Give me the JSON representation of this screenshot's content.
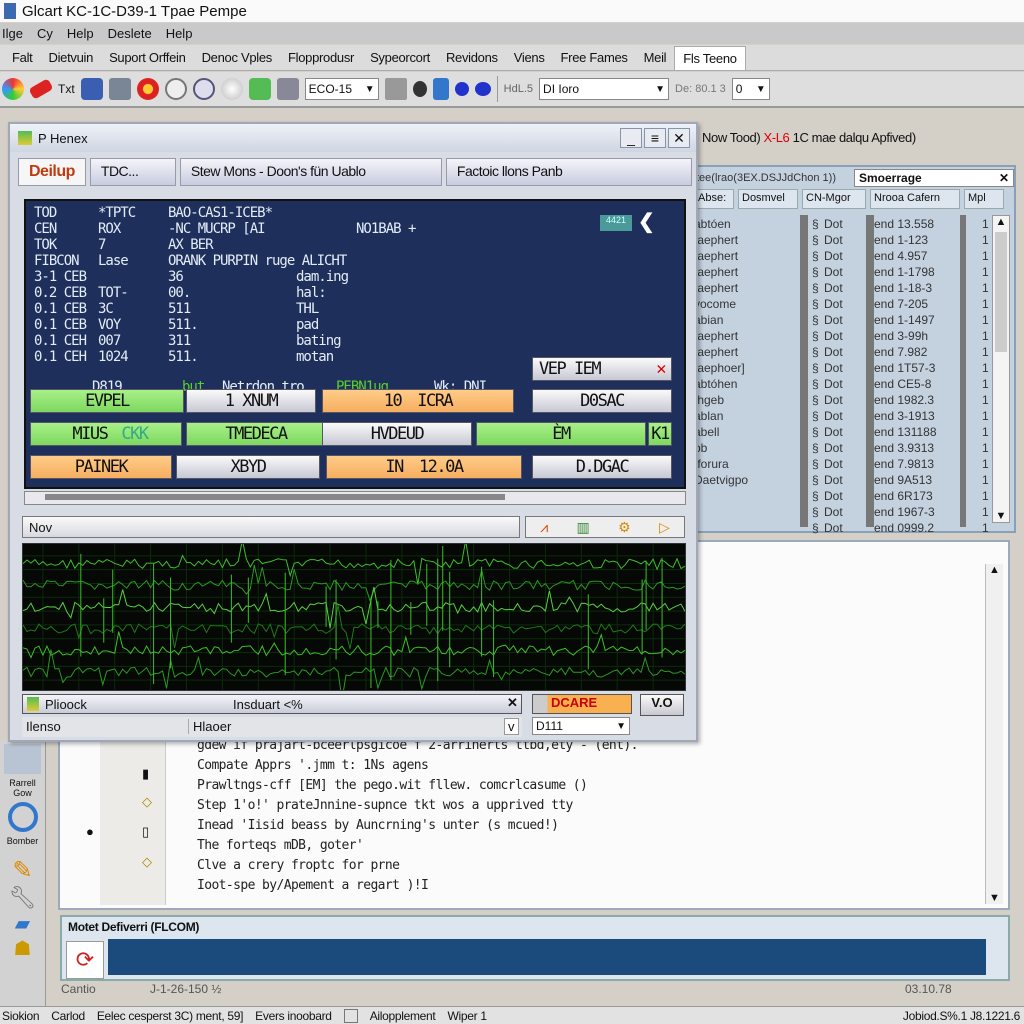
{
  "window_title": "Glcart KC-1C-D39-1 Tpae Pempe",
  "menu_primary": [
    "Ilge",
    "Cy",
    "Help",
    "Deslete",
    "Help"
  ],
  "menu_secondary": {
    "items": [
      "Falt",
      "Dietvuin",
      "Suport Orffein",
      "Denoc Vples",
      "Flopprodusr",
      "Sypeorcort",
      "Revidons",
      "Viens",
      "Free Fames",
      "Meil",
      "Fls Teeno"
    ],
    "selected": "Fls Teeno"
  },
  "toolbar": {
    "icons": [
      "color-wheel-icon",
      "eraser-icon",
      "text-icon",
      "database-icon",
      "tools-icon",
      "stop-icon",
      "shield-icon",
      "check-shield-icon",
      "globe-icon",
      "printer-icon",
      "network-icon"
    ],
    "text_button": "Txt",
    "combo1": "ECO-15",
    "more_icons": [
      "print-icon",
      "bug-icon",
      "drop-icon",
      "gear-icon",
      "hex-icon"
    ],
    "label2": "HdL.5",
    "combo2": "DI Ioro",
    "label3": "De: 80.1 3",
    "combo3": "0"
  },
  "notice": {
    "prefix": "Now Tood)",
    "highlight": "X-L6",
    "suffix": "1C mae dalqu Apfived)"
  },
  "right_panel": {
    "path": "tee(lrao(3EX.DSJJdChon 1))",
    "search_value": "Smoerrage",
    "columns": [
      "Abse:",
      "Dosmvel",
      "CN-Mgor",
      "Nrooa Cafern",
      "Mpl"
    ],
    "rows": [
      {
        "name": "abtóen",
        "status": "Dot",
        "value": "end 13.558",
        "n": "1"
      },
      {
        "name": "taephert",
        "status": "Dot",
        "value": "end 1-123",
        "n": "1"
      },
      {
        "name": "taephert",
        "status": "Dot",
        "value": "end 4.957",
        "n": "1"
      },
      {
        "name": "taephert",
        "status": "Dot",
        "value": "end 1-1798",
        "n": "1"
      },
      {
        "name": "taephert",
        "status": "Dot",
        "value": "end 1-18-3",
        "n": "1"
      },
      {
        "name": "vocome",
        "status": "Dot",
        "value": "end 7-205",
        "n": "1"
      },
      {
        "name": "abian",
        "status": "Dot",
        "value": "end 1-1497",
        "n": "1"
      },
      {
        "name": "taephert",
        "status": "Dot",
        "value": "end 3-99h",
        "n": "1"
      },
      {
        "name": "taephert",
        "status": "Dot",
        "value": "end 7.982",
        "n": "1"
      },
      {
        "name": "taephoer]",
        "status": "Dot",
        "value": "end 1T57-3",
        "n": "1"
      },
      {
        "name": "abtóhen",
        "status": "Dot",
        "value": "end CE5-8",
        "n": "1"
      },
      {
        "name": "Ihgeb",
        "status": "Dot",
        "value": "end 1982.3",
        "n": "1"
      },
      {
        "name": "ablan",
        "status": "Dot",
        "value": "end 3-1913",
        "n": "1"
      },
      {
        "name": "abell",
        "status": "Dot",
        "value": "end 131188",
        "n": "1"
      },
      {
        "name": "bb",
        "status": "Dot",
        "value": "end 3.9313",
        "n": "1"
      },
      {
        "name": "Iforura",
        "status": "Dot",
        "value": "end 7.9813",
        "n": "1"
      },
      {
        "name": "Daetvigpo",
        "status": "Dot",
        "value": "end 9A513",
        "n": "1"
      },
      {
        "name": "",
        "status": "Dot",
        "value": "end 6R173",
        "n": "1"
      },
      {
        "name": "",
        "status": "Dot",
        "value": "end 1967-3",
        "n": "1"
      },
      {
        "name": "",
        "status": "Dot",
        "value": "end 0999.2",
        "n": "1"
      }
    ]
  },
  "float_window": {
    "title": "P Henex",
    "tabs": [
      "Deilup",
      "TDC...",
      "Stew Mons - Doon's fün Uablo",
      "Factoic llons Panb"
    ],
    "active_tab": "Deilup",
    "terminal_lines": [
      [
        "TOD",
        "*TPTC",
        "BAO-CAS1-ICEB*",
        ""
      ],
      [
        "CEN",
        "ROX",
        "-NC MUCRP [AI",
        "NO1BAB +"
      ],
      [
        "TOK",
        "7",
        "AX BER",
        ""
      ],
      [
        "FIBCON",
        "Lase",
        "ORANK PURPIN ruge ALICHT",
        ""
      ],
      [
        "3-1 CEB",
        "",
        "36",
        "dam.ing"
      ],
      [
        "0.2 CEB",
        "TOT-",
        "00.",
        "hal:"
      ],
      [
        "0.1 CEB",
        "3C",
        "511",
        "THL"
      ],
      [
        "0.1 CEB",
        "VOY",
        "511.",
        "pad"
      ],
      [
        "0.1 CEH",
        "007",
        "311",
        "bating"
      ],
      [
        "0.1 CEH",
        "1024",
        "511.",
        "motan"
      ]
    ],
    "terminal_status": {
      "code": "D819",
      "green1": "but",
      "text": "Netrdon tro",
      "green2": "PEBN1ug",
      "tail": "Wk: DNI"
    },
    "terminal_badge": "4421",
    "vep_label": "VEP IEM",
    "buttons": [
      [
        {
          "label": "EVPEL",
          "style": "green"
        },
        {
          "label": "1 XNUM",
          "style": "silver"
        },
        {
          "label": "10",
          "style": "silver"
        },
        {
          "label": "ICRA",
          "style": "orange"
        },
        {
          "label": "D0SAC",
          "style": "silver"
        }
      ],
      [
        {
          "label": "MIUS",
          "extra": "CKK",
          "style": "green"
        },
        {
          "label": "TMEDECA",
          "style": "green"
        },
        {
          "label": "HVDEUD",
          "style": "silver"
        },
        {
          "label": "ÈM",
          "style": "green"
        },
        {
          "label": "K1",
          "style": "green"
        }
      ],
      [
        {
          "label": "PAINEK",
          "style": "orange"
        },
        {
          "label": "XBYD",
          "style": "silver"
        },
        {
          "label": "IN",
          "style": "silver"
        },
        {
          "label": "12.0A",
          "style": "orange"
        },
        {
          "label": "D.DGAC",
          "style": "silver"
        }
      ]
    ],
    "nov_label": "Nov",
    "bottom": {
      "left": "Plioock",
      "center": "Insduart <%",
      "care": "DCARE",
      "version": "V.O",
      "row2_left": "Ilenso",
      "row2_mid": "Hlaoer",
      "row2_v": "v",
      "select": "D111"
    }
  },
  "left_toolbar": {
    "labels": [
      "Rarrell Gow",
      "Bomber"
    ]
  },
  "editor_lines": [
    "gdew if prajart-bceerlpsgicoe f 2-arrinerts ttbd,ety - (ent).",
    "Compate Apprs '.jmm t: 1Ns agens",
    "Prawltngs-cff [EM] the pego.wit fllew. comcrlcasume ()",
    "Step 1'o!' prateJnnine-supnce tkt wos a upprived tty",
    "Inead 'Iisid beass by Auncrning's unter (s mcued!)",
    "The forteqs mDB, goter'",
    "Clve a crery froptc for prne",
    "Ioot-spe by/Apement a regart )!I"
  ],
  "output_panel": {
    "title": "Motet Defiverri (FLCOM)"
  },
  "status_line": {
    "left": "Cantio",
    "mid": "J-1-26-150 ½",
    "right": "03.10.78"
  },
  "status_bar": [
    "Siokion",
    "Carlod",
    "Eelec cesperst 3C) ment, 59]",
    "Evers inoobard",
    "Ailopplement",
    "Wiper 1",
    "Jobiod.S%.1 J8.1221.6"
  ],
  "colors": {
    "terminal_bg": "#1d2f5a",
    "accent_green": "#7dd860",
    "accent_orange": "#f6ae60",
    "output_bg": "#1b4a7c",
    "alert_red": "#d00000"
  }
}
